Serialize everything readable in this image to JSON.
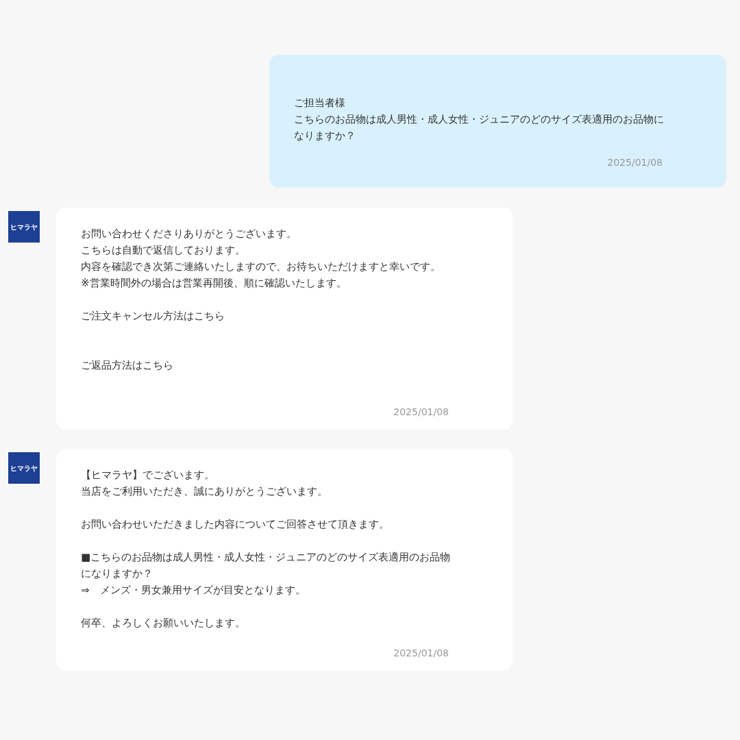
{
  "messages": [
    {
      "outgoing": true,
      "paragraphs": [
        {
          "kind": "text",
          "lines": [
            "ご担当者様",
            "こちらのお品物は成人男性・成人女性・ジュニアのどのサイズ表適用のお品物に",
            "なりますか？"
          ]
        }
      ],
      "date": "2025/01/08"
    },
    {
      "outgoing": false,
      "avatar_label": "ヒマラヤ",
      "paragraphs": [
        {
          "kind": "text",
          "lines": [
            "お問い合わせくださりありがとうございます。",
            "こちらは自動で返信しております。",
            "内容を確認でき次第ご連絡いたしますので、お待ちいただけますと幸いです。",
            "※営業時間外の場合は営業再開後、順に確認いたします。"
          ]
        },
        {
          "kind": "link",
          "lines": [
            "ご注文キャンセル方法はこちら"
          ]
        },
        {
          "kind": "link",
          "lines": [
            "ご返品方法はこちら"
          ]
        }
      ],
      "date": "2025/01/08"
    },
    {
      "outgoing": false,
      "avatar_label": "ヒマラヤ",
      "paragraphs": [
        {
          "kind": "text",
          "lines": [
            "【ヒマラヤ】でございます。",
            "当店をご利用いただき、誠にありがとうございます。"
          ]
        },
        {
          "kind": "text",
          "lines": [
            "お問い合わせいただきました内容についてご回答させて頂きます。"
          ]
        },
        {
          "kind": "text",
          "lines": [
            "■こちらのお品物は成人男性・成人女性・ジュニアのどのサイズ表適用のお品物",
            "になりますか？",
            "⇒　メンズ・男女兼用サイズが目安となります。"
          ]
        },
        {
          "kind": "text",
          "lines": [
            "何卒、よろしくお願いいたします。"
          ]
        }
      ],
      "date": "2025/01/08"
    }
  ]
}
